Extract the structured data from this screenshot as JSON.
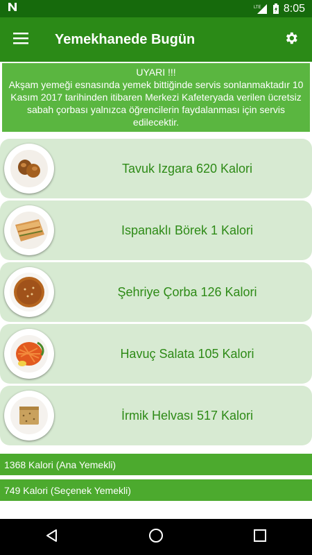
{
  "status_bar": {
    "notification_icon": "n-icon",
    "signal": "LTE",
    "battery_icon": "battery-charging-icon",
    "time": "8:05"
  },
  "app_bar": {
    "title": "Yemekhanede Bugün",
    "menu_icon": "hamburger-menu-icon",
    "settings_icon": "gear-icon"
  },
  "warning": {
    "title": "UYARI !!!",
    "body": "Akşam yemeği esnasında yemek bittiğinde servis sonlanmaktadır      10 Kasım 2017 tarihinden itibaren Merkezi Kafeteryada verilen ücretsiz sabah çorbası yalnızca öğrencilerin faydalanması için servis edilecektir."
  },
  "menu": [
    {
      "label": "Tavuk Izgara 620 Kalori",
      "image": "grilled-chicken-image"
    },
    {
      "label": "Ispanaklı Börek 1 Kalori",
      "image": "spinach-borek-image"
    },
    {
      "label": "Şehriye Çorba 126 Kalori",
      "image": "noodle-soup-image"
    },
    {
      "label": "Havuç Salata 105 Kalori",
      "image": "carrot-salad-image"
    },
    {
      "label": "İrmik Helvası 517 Kalori",
      "image": "semolina-halva-image"
    }
  ],
  "totals": [
    {
      "label": "1368 Kalori (Ana Yemekli)"
    },
    {
      "label": "749 Kalori (Seçenek Yemekli)"
    }
  ],
  "colors": {
    "status_bar": "#166a0c",
    "app_bar": "#2b8a17",
    "warning_bg": "#5ab640",
    "card_bg": "#d7ead2",
    "card_text": "#2d8a16",
    "summary_bg": "#4caa2e"
  }
}
